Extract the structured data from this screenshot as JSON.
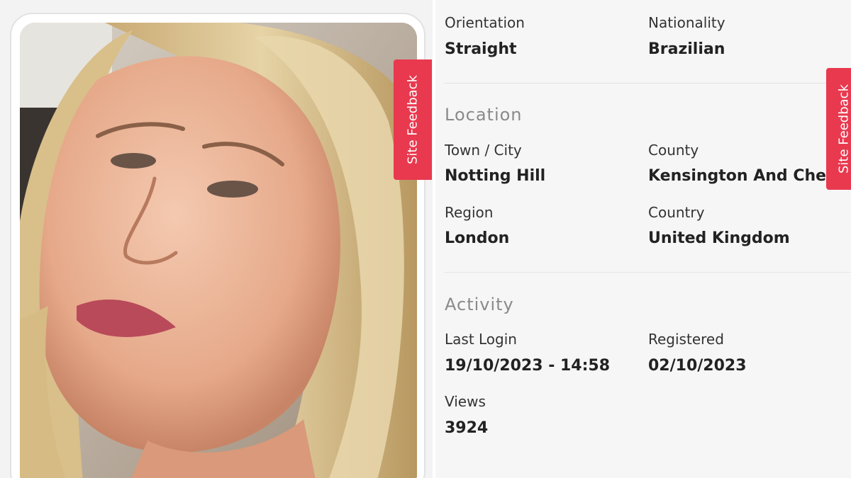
{
  "feedback": {
    "label": "Site Feedback"
  },
  "profile": {
    "orientation": {
      "label": "Orientation",
      "value": "Straight"
    },
    "nationality": {
      "label": "Nationality",
      "value": "Brazilian"
    }
  },
  "location": {
    "title": "Location",
    "town": {
      "label": "Town / City",
      "value": "Notting Hill"
    },
    "county": {
      "label": "County",
      "value": "Kensington And Chelsea"
    },
    "region": {
      "label": "Region",
      "value": "London"
    },
    "country": {
      "label": "Country",
      "value": "United Kingdom"
    }
  },
  "activity": {
    "title": "Activity",
    "last_login": {
      "label": "Last Login",
      "value": "19/10/2023 - 14:58"
    },
    "registered": {
      "label": "Registered",
      "value": "02/10/2023"
    },
    "views": {
      "label": "Views",
      "value": "3924"
    }
  },
  "colors": {
    "feedback_tab": "#e8394f",
    "section_title": "#8a8a8a",
    "panel_background": "#f6f6f6"
  }
}
